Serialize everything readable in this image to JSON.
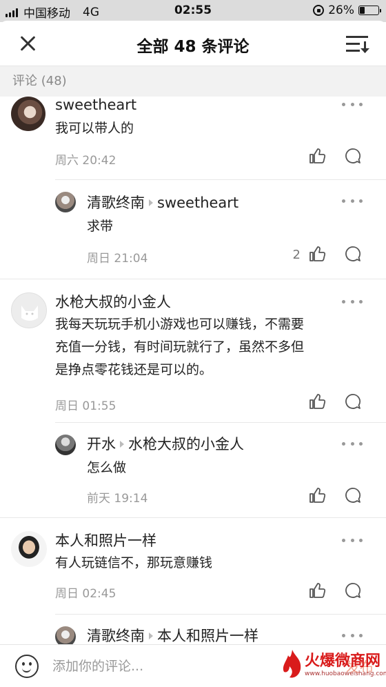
{
  "status_bar": {
    "carrier": "中国移动",
    "network": "4G",
    "time": "02:55",
    "battery": "26%",
    "battery_level": 0.26
  },
  "header": {
    "title": "全部 48 条评论"
  },
  "section_label": "评论 (48)",
  "comments": [
    {
      "user": "sweetheart",
      "text": "我可以带人的",
      "time": "周六 20:42",
      "replies": [
        {
          "user": "清歌终南",
          "reply_to": "sweetheart",
          "text": "求带",
          "time": "周日 21:04",
          "likes": "2"
        }
      ]
    },
    {
      "user": "水枪大叔的小金人",
      "text_lines": [
        "我每天玩玩手机小游戏也可以赚钱，不需要",
        "充值一分钱，有时间玩就行了，虽然不多但",
        "是挣点零花钱还是可以的。"
      ],
      "time": "周日 01:55",
      "replies": [
        {
          "user": "开水",
          "reply_to": "水枪大叔的小金人",
          "text": "怎么做",
          "time": "前天 19:14"
        }
      ]
    },
    {
      "user": "本人和照片一样",
      "text": "有人玩链信不，那玩意赚钱",
      "time": "周日 02:45",
      "replies": [
        {
          "user": "清歌终南",
          "reply_to": "本人和照片一样"
        }
      ]
    }
  ],
  "input": {
    "placeholder": "添加你的评论...",
    "send_label": "发布"
  },
  "watermark": {
    "cn": "火爆微商网",
    "en": "www.huobaoweishang.com"
  },
  "colors": {
    "header_bg": "#dcdcdc",
    "section_bg": "#f2f2f2",
    "send": "#f3a58f",
    "watermark": "#d91b1b"
  }
}
